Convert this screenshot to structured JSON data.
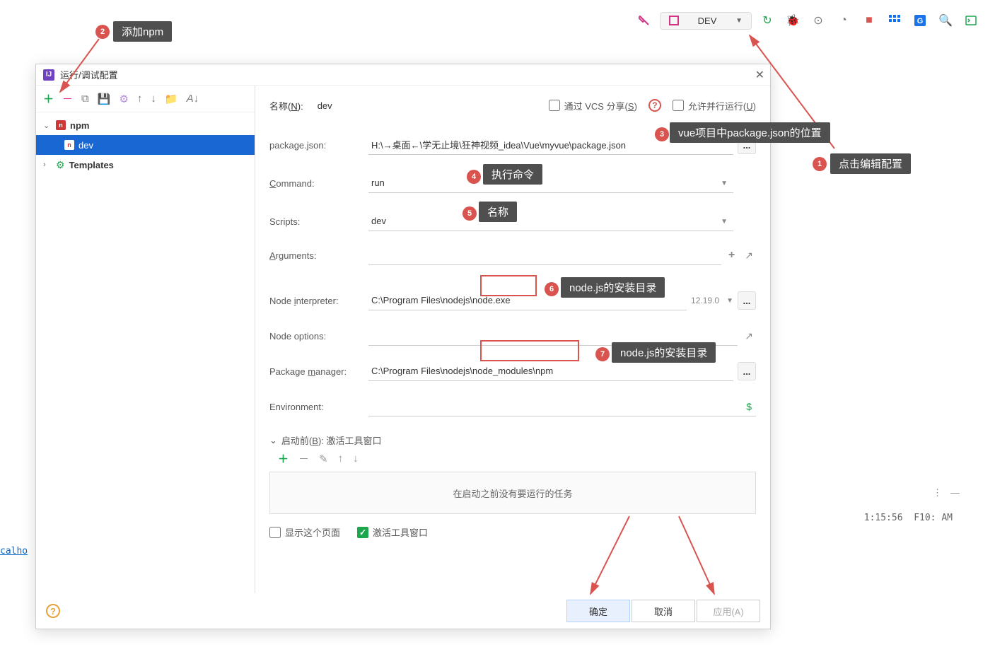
{
  "topbar": {
    "run_config_label": "DEV"
  },
  "dialog": {
    "title": "运行/调试配置",
    "toolbar": {
      "name_label": "名称",
      "name_key": "N",
      "name_value": "dev",
      "vcs_share": "通过 VCS 分享",
      "vcs_key": "S",
      "allow_parallel": "允许并行运行",
      "parallel_key": "U"
    },
    "tree": {
      "npm": "npm",
      "dev": "dev",
      "templates": "Templates"
    },
    "form": {
      "package_json_label": "package.json:",
      "package_json_value": "H:\\→桌面←\\学无止境\\狂神视频_idea\\Vue\\myvue\\package.json",
      "command_label": "ommand:",
      "command_key": "C",
      "command_value": "run",
      "scripts_label": "Scripts:",
      "scripts_value": "dev",
      "arguments_label": "rguments:",
      "arguments_key": "A",
      "node_interpreter_label": "Node ",
      "node_interpreter_key": "i",
      "node_interpreter_label2": "nterpreter:",
      "node_interpreter_value": "C:\\Program Files\\nodejs\\node.exe",
      "node_version": "12.19.0",
      "node_options_label": "Node options:",
      "package_manager_label": "Package ",
      "package_manager_key": "m",
      "package_manager_label2": "anager:",
      "package_manager_value": "C:\\Program Files\\nodejs\\node_modules\\npm",
      "environment_label": "Environment:",
      "before_launch_label": "启动前",
      "before_launch_key": "B",
      "before_launch_suffix": ": 激活工具窗口",
      "no_tasks": "在启动之前没有要运行的任务",
      "show_page": "显示这个页面",
      "activate_tool": "激活工具窗口"
    },
    "buttons": {
      "ok": "确定",
      "cancel": "取消",
      "apply": "应用(A)"
    }
  },
  "annotations": {
    "a1": "点击编辑配置",
    "a2": "添加npm",
    "a3": "vue项目中package.json的位置",
    "a4": "执行命令",
    "a5": "名称",
    "a6": "node.js的安装目录",
    "a7": "node.js的安装目录"
  },
  "status": {
    "time": "1:15:56",
    "extra": "F10: AM",
    "link": "calho"
  }
}
